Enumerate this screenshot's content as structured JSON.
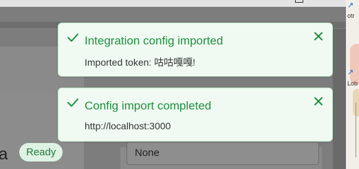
{
  "toasts": [
    {
      "title": "Integration config imported",
      "message": "Imported token: 咕咕嘎嘎!"
    },
    {
      "title": "Config import completed",
      "message": "http://localhost:3000"
    }
  ],
  "background": {
    "card_title_fragment": "a",
    "status_badge": "Ready",
    "select_value": "None"
  },
  "desktop": {
    "label_top": "otr",
    "label_bottom": "Lob",
    "icon_top": "shortcut-arrow-icon",
    "icon_bottom": "shortcut-arrow-icon"
  },
  "colors": {
    "toast_accent": "#1e8f3f",
    "toast_background": "#f0faf2",
    "badge_background": "#dff3e4"
  }
}
